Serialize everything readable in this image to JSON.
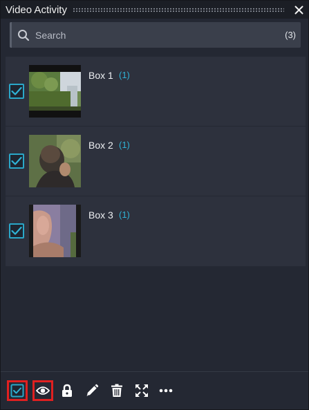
{
  "window": {
    "title": "Video Activity"
  },
  "search": {
    "placeholder": "Search",
    "count": "(3)"
  },
  "items": [
    {
      "label": "Box 1",
      "count": "(1)",
      "checked": true
    },
    {
      "label": "Box 2",
      "count": "(1)",
      "checked": true
    },
    {
      "label": "Box 3",
      "count": "(1)",
      "checked": true
    }
  ],
  "toolbar": {
    "tools": [
      "checkbox-icon",
      "eye-icon",
      "lock-icon",
      "pencil-icon",
      "trash-icon",
      "expand-icon",
      "more-icon"
    ],
    "highlighted": [
      "select-all",
      "visibility"
    ]
  },
  "colors": {
    "accent": "#2aa8c9",
    "count_text": "#2fb3d6",
    "highlight_border": "#e02020",
    "panel_bg": "#242833",
    "list_bg": "#2d313d"
  }
}
